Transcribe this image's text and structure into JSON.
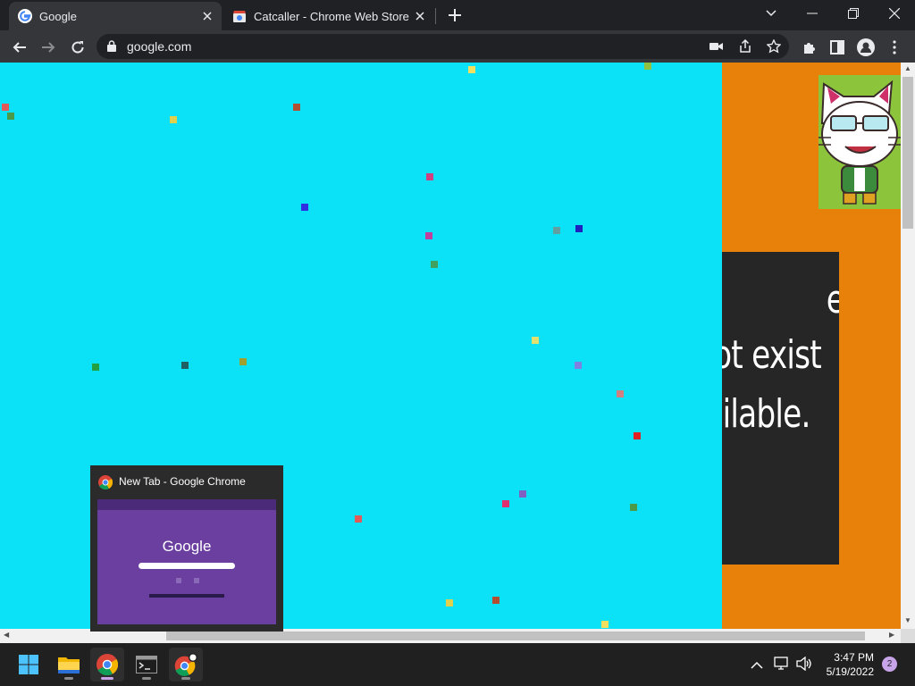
{
  "tabs": [
    {
      "title": "Google",
      "active": true,
      "favicon": "google-g-icon"
    },
    {
      "title": "Catcaller - Chrome Web Store",
      "active": false,
      "favicon": "chrome-web-store-icon"
    }
  ],
  "omnibox": {
    "url": "google.com"
  },
  "page": {
    "background_color": "#0be2f8",
    "side_panel_color": "#e8810a",
    "message_lines": [
      "e",
      "ot exist",
      "ailable."
    ]
  },
  "taskbar_preview": {
    "title": "New Tab - Google Chrome",
    "thumbnail_logo": "Google"
  },
  "taskbar": {
    "time": "3:47 PM",
    "date": "5/19/2022",
    "notification_count": "2",
    "apps": [
      "start-icon",
      "file-explorer-icon",
      "chrome-icon",
      "terminal-icon",
      "chrome-profile-icon"
    ]
  },
  "confetti_colors": [
    "#e05a5a",
    "#4a9a4a",
    "#e0d050",
    "#b05030",
    "#f0e060",
    "#90c040",
    "#d04080",
    "#3030e0",
    "#c040a0",
    "#60a0a0",
    "#2020c0",
    "#40a060",
    "#e0e070",
    "#20a040",
    "#206060",
    "#a0a030",
    "#8080e0",
    "#d08080",
    "#e02020",
    "#e03070",
    "#8060c0"
  ]
}
